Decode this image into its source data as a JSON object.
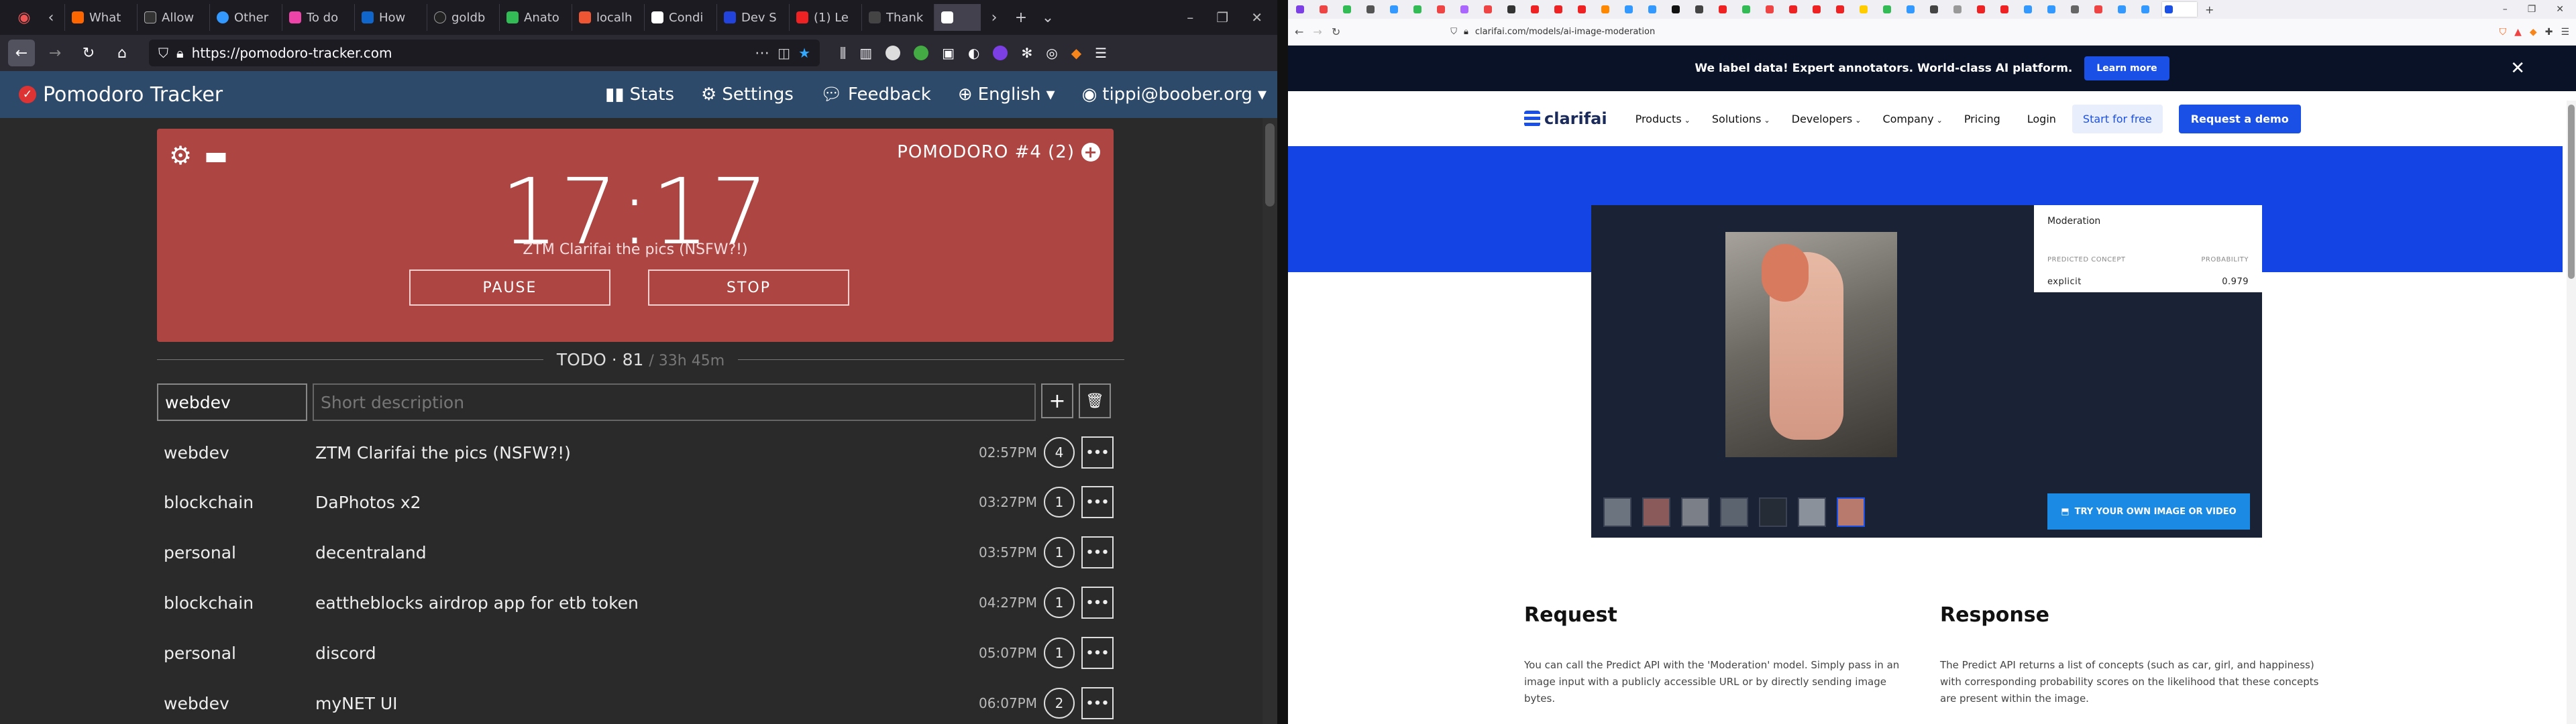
{
  "left": {
    "tabs": [
      {
        "label": "What"
      },
      {
        "label": "Allow"
      },
      {
        "label": "Other"
      },
      {
        "label": "To do"
      },
      {
        "label": "How"
      },
      {
        "label": "goldb"
      },
      {
        "label": "Anato"
      },
      {
        "label": "localh"
      },
      {
        "label": "Condi"
      },
      {
        "label": "Dev S"
      },
      {
        "label": "(1) Le"
      },
      {
        "label": "Thank"
      }
    ],
    "url": "https://pomodoro-tracker.com",
    "app": {
      "brand": "Pomodoro Tracker",
      "menu": [
        "Stats",
        "Settings",
        "Feedback",
        "English",
        "tippi@boober.org"
      ],
      "timer": {
        "counter": "POMODORO #4 (2)",
        "time": "17:17",
        "task": "ZTM Clarifai the pics (NSFW?!)",
        "pause": "PAUSE",
        "stop": "STOP"
      },
      "todo_header": "TODO · 81",
      "todo_total": "/ 33h 45m",
      "new_category": "webdev",
      "description_placeholder": "Short description",
      "tasks": [
        {
          "category": "webdev",
          "desc": "ZTM Clarifai the pics (NSFW?!)",
          "time": "02:57PM",
          "count": "4"
        },
        {
          "category": "blockchain",
          "desc": "DaPhotos x2",
          "time": "03:27PM",
          "count": "1"
        },
        {
          "category": "personal",
          "desc": "decentraland",
          "time": "03:57PM",
          "count": "1"
        },
        {
          "category": "blockchain",
          "desc": "eattheblocks airdrop app for etb token",
          "time": "04:27PM",
          "count": "1"
        },
        {
          "category": "personal",
          "desc": "discord",
          "time": "05:07PM",
          "count": "1"
        },
        {
          "category": "webdev",
          "desc": "myNET UI",
          "time": "06:07PM",
          "count": "2"
        }
      ]
    }
  },
  "right": {
    "url": "clarifai.com/models/ai-image-moderation",
    "banner": {
      "text": "We label data!  Expert annotators. World-class AI platform.",
      "button": "Learn more"
    },
    "nav": {
      "logo": "clarifai",
      "links": [
        "Products",
        "Solutions",
        "Developers",
        "Company",
        "Pricing"
      ],
      "login": "Login",
      "start": "Start for free",
      "demo": "Request a demo"
    },
    "demo": {
      "model": "Moderation",
      "col_concept": "PREDICTED CONCEPT",
      "col_prob": "PROBABILITY",
      "concept": "explicit",
      "probability": "0.979",
      "try_button": "TRY YOUR OWN IMAGE OR VIDEO"
    },
    "request": {
      "title": "Request",
      "text": "You can call the Predict API with the 'Moderation' model. Simply pass in an image input with a publicly accessible URL or by directly sending image bytes."
    },
    "response": {
      "title": "Response",
      "text": "The Predict API returns a list of concepts (such as car, girl, and happiness) with corresponding probability scores on the likelihood that these concepts are present within the image."
    }
  }
}
